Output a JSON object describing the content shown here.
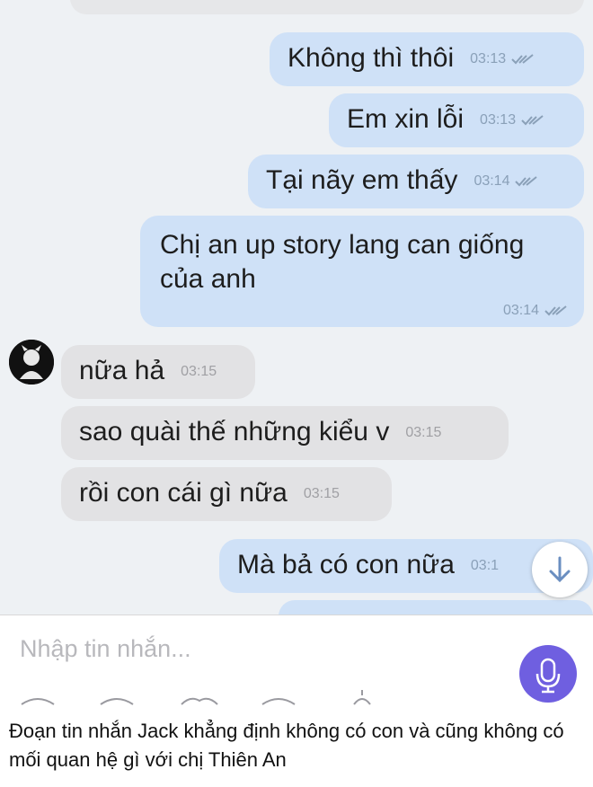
{
  "messages": [
    {
      "dir": "out",
      "text": "Không thì thôi",
      "time": "03:13"
    },
    {
      "dir": "out",
      "text": "Em xin lỗi",
      "time": "03:13"
    },
    {
      "dir": "out",
      "text": "Tại nãy em thấy",
      "time": "03:14"
    },
    {
      "dir": "out",
      "text_line1": "Chị an up story lang can giống",
      "text_line2": "của anh",
      "time": "03:14"
    },
    {
      "dir": "in",
      "text": "nữa hả",
      "time": "03:15"
    },
    {
      "dir": "in",
      "text": "sao quài thế những kiểu v",
      "time": "03:15"
    },
    {
      "dir": "in",
      "text": "rồi con cái gì nữa",
      "time": "03:15"
    },
    {
      "dir": "out",
      "text": "Mà bả có con nữa",
      "time": "03:1"
    }
  ],
  "input": {
    "placeholder": "Nhập tin nhắn..."
  },
  "caption": "Đoạn tin nhắn Jack khẳng định không có con và cũng không có mối quan hệ gì với chị Thiên An",
  "colors": {
    "outgoing_bubble": "#cfe1f7",
    "incoming_bubble": "#e2e2e4",
    "mic_button": "#6f5fe0"
  },
  "icons": [
    "double-check-icon",
    "scroll-down-arrow-icon",
    "microphone-icon",
    "avatar"
  ]
}
